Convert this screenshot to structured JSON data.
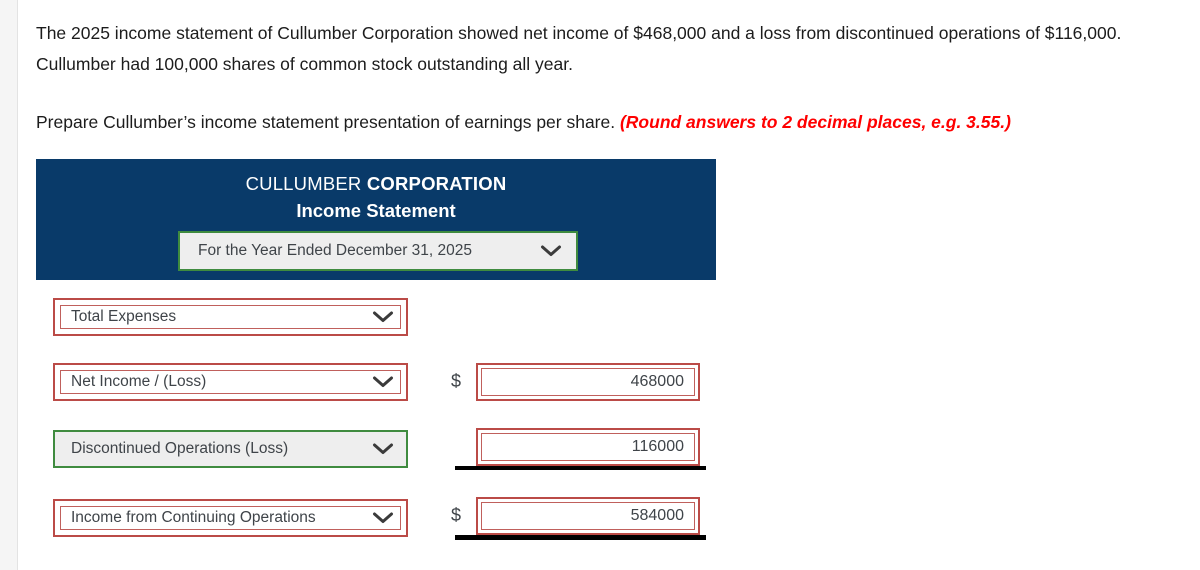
{
  "question": {
    "paragraph_1": "The 2025 income statement of Cullumber Corporation showed net income of $468,000 and a loss from discontinued operations of $116,000. Cullumber had 100,000 shares of common stock outstanding all year.",
    "paragraph_2_prefix": "Prepare Cullumber’s income statement presentation of earnings per share. ",
    "paragraph_2_note": "(Round answers to 2 decimal places, e.g. 3.55.)"
  },
  "statement": {
    "company_name_light": "CULLUMBER ",
    "company_name_bold": "CORPORATION",
    "title": "Income Statement",
    "period_select": {
      "value": "For the Year Ended December 31, 2025",
      "state": "accepted",
      "icon": "chevron-down-icon"
    },
    "rows": [
      {
        "label_select": "Total Expenses",
        "label_state": "blank",
        "dollar_sign": "",
        "amount": "",
        "rule": "none"
      },
      {
        "label_select": "Net Income / (Loss)",
        "label_state": "blank",
        "dollar_sign": "$",
        "amount": "468000",
        "rule": "none"
      },
      {
        "label_select": "Discontinued Operations (Loss)",
        "label_state": "accepted",
        "dollar_sign": "",
        "amount": "116000",
        "rule": "single"
      },
      {
        "label_select": "Income from Continuing Operations",
        "label_state": "blank",
        "dollar_sign": "$",
        "amount": "584000",
        "rule": "total"
      }
    ]
  },
  "colors": {
    "header_navy": "#093a69",
    "blank_red": "#bb4b47",
    "accepted_green": "#3f8b3f",
    "note_red": "#ff0000",
    "rule_black": "#000000",
    "accepted_fill": "#eeeeee"
  }
}
